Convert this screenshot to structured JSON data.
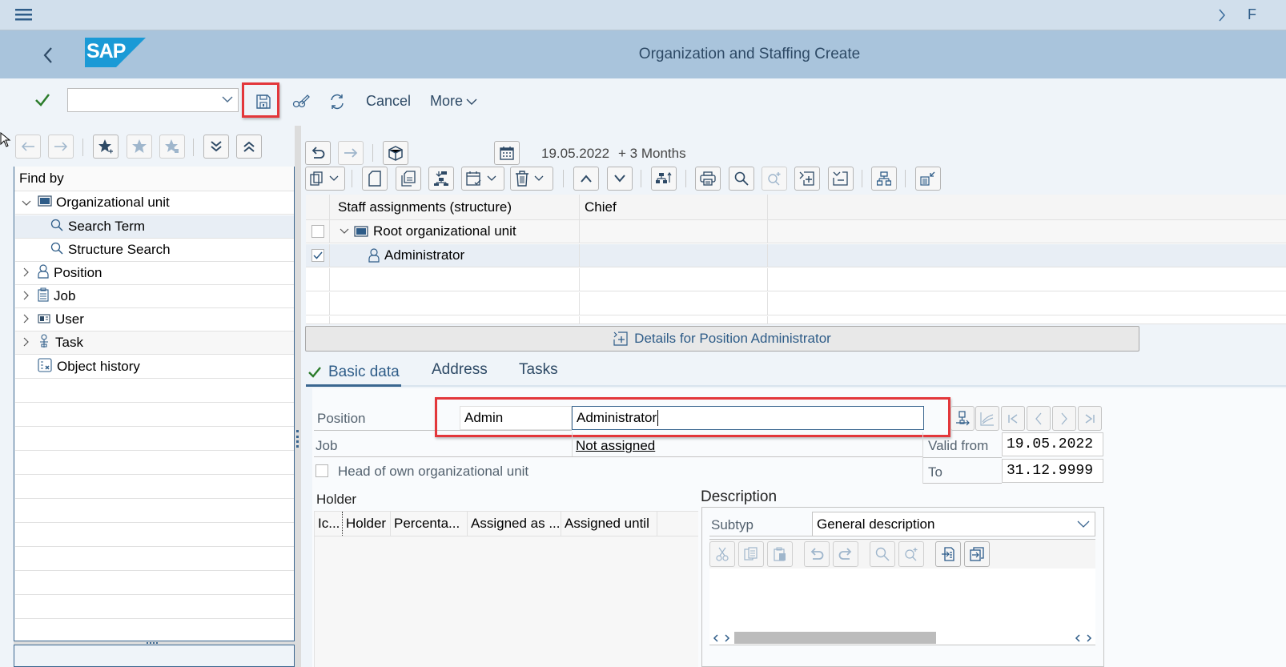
{
  "shell": {
    "menu_icon": "hamburger-menu-icon",
    "right_chevron": "chevron-right-icon",
    "right_truncated_text": "F"
  },
  "header": {
    "back_icon": "back-arrow-icon",
    "logo_text": "SAP",
    "title": "Organization and Staffing Create"
  },
  "toolbar": {
    "command_field_value": "",
    "cancel_label": "Cancel",
    "more_label": "More"
  },
  "left_panel": {
    "find_by_label": "Find by",
    "tree": [
      {
        "label": "Organizational unit",
        "icon": "org-unit-icon",
        "expanded": true
      },
      {
        "label": "Search Term",
        "icon": "search-icon",
        "selected": true
      },
      {
        "label": "Structure Search",
        "icon": "search-icon"
      },
      {
        "label": "Position",
        "icon": "position-person-icon"
      },
      {
        "label": "Job",
        "icon": "job-clipboard-icon"
      },
      {
        "label": "User",
        "icon": "user-card-icon"
      },
      {
        "label": "Task",
        "icon": "task-icon"
      },
      {
        "label": "Object history",
        "icon": "object-history-icon"
      }
    ]
  },
  "right_panel": {
    "date_text": "19.05.2022",
    "period_text": "+ 3 Months",
    "structure_table": {
      "columns": [
        "Staff assignments (structure)",
        "Chief"
      ],
      "rows": [
        {
          "checked": false,
          "label": "Root organizational unit",
          "chief": "",
          "icon": "org-unit-icon"
        },
        {
          "checked": true,
          "label": "Administrator",
          "chief": "",
          "icon": "position-person-icon"
        }
      ]
    },
    "details_button": "Details for Position Administrator",
    "tabs": [
      {
        "label": "Basic data",
        "active": true
      },
      {
        "label": "Address",
        "active": false
      },
      {
        "label": "Tasks",
        "active": false
      }
    ]
  },
  "basic_data": {
    "position_label": "Position",
    "position_short": "Admin",
    "position_long": "Administrator",
    "job_label": "Job",
    "job_value": "Not assigned",
    "valid_from_label": "Valid from",
    "valid_from": "19.05.2022",
    "to_label": "To",
    "to_value": "31.12.9999",
    "head_checkbox_label": "Head of own organizational unit",
    "head_checked": false,
    "holder_title": "Holder",
    "holder_columns": [
      "Ic...",
      "Holder",
      "Percenta...",
      "Assigned as ...",
      "Assigned until"
    ],
    "description_title": "Description",
    "subtype_label": "Subtyp",
    "subtype_value": "General description"
  },
  "colors": {
    "accent": "#2b5b8a",
    "highlight_box": "#e3373b",
    "success": "#2b7c2b",
    "sap_logo": "#1b9ad6"
  }
}
